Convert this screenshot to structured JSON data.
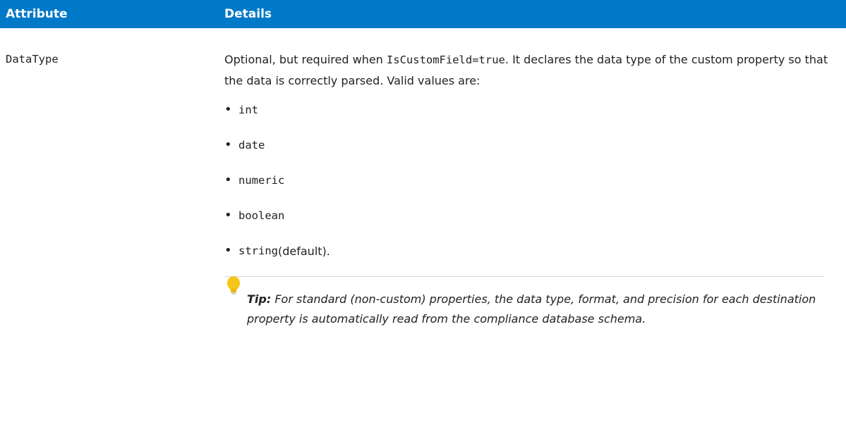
{
  "table": {
    "header": {
      "attribute": "Attribute",
      "details": "Details"
    },
    "row": {
      "attribute_name": "DataType",
      "details": {
        "part1": "Optional, but required when ",
        "code1": "IsCustomField=true",
        "part2": ". It declares the data type of the custom property so that the data is correctly parsed. Valid values are:"
      },
      "values": [
        {
          "code": "int",
          "suffix": ""
        },
        {
          "code": "date",
          "suffix": ""
        },
        {
          "code": "numeric",
          "suffix": ""
        },
        {
          "code": "boolean",
          "suffix": ""
        },
        {
          "code": "string",
          "suffix": " (default)."
        }
      ],
      "tip": {
        "label": "Tip:",
        "text": " For standard (non-custom) properties, the data type, format, and precision for each destination property is automatically read from the compliance database schema.",
        "icon": "lightbulb-icon",
        "icon_color": "#f5c518"
      }
    }
  },
  "colors": {
    "header_bg": "#0079c8",
    "header_text": "#ffffff"
  }
}
